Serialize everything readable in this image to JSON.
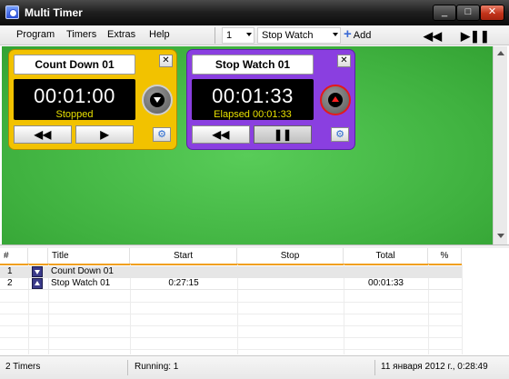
{
  "window": {
    "title": "Multi Timer",
    "minimize": "_",
    "maximize": "□",
    "close": "✕"
  },
  "menu": {
    "items": [
      "Program",
      "Timers",
      "Extras",
      "Help"
    ]
  },
  "toolbar": {
    "count_value": "1",
    "type_value": "Stop Watch",
    "add_label": "Add",
    "rewind_icon": "◀◀",
    "play_pause_icon": "▶❚❚"
  },
  "timers": [
    {
      "title": "Count Down 01",
      "time": "00:01:00",
      "status": "Stopped",
      "color": "#f2c200",
      "close": "✕",
      "rewind": "◀◀",
      "action": "▶",
      "settings": "⚙"
    },
    {
      "title": "Stop Watch 01",
      "time": "00:01:33",
      "status": "Elapsed 00:01:33",
      "color": "#8a3fe0",
      "close": "✕",
      "rewind": "◀◀",
      "action": "❚❚",
      "settings": "⚙"
    }
  ],
  "table": {
    "headers": [
      "#",
      "",
      "Title",
      "Start",
      "Stop",
      "Total",
      "%"
    ],
    "rows": [
      {
        "num": "1",
        "direction": "down",
        "title": "Count Down 01",
        "start": "",
        "stop": "",
        "total": "",
        "percent": ""
      },
      {
        "num": "2",
        "direction": "up",
        "title": "Stop Watch 01",
        "start": "0:27:15",
        "stop": "",
        "total": "00:01:33",
        "percent": ""
      }
    ]
  },
  "statusbar": {
    "timers": "2 Timers",
    "running": "Running: 1",
    "datetime": "11 января 2012 г., 0:28:49"
  }
}
